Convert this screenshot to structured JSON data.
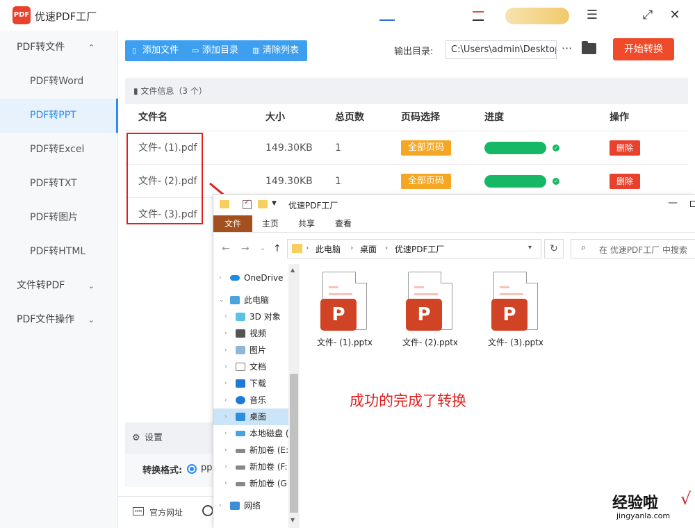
{
  "app": {
    "logo_text": "PDF",
    "title": "优速PDF工厂",
    "menu_glyph": "☰",
    "fullscreen_glyph": "⤢",
    "close_glyph": "✕"
  },
  "sidebar": {
    "groups": [
      {
        "label": "PDF转文件",
        "chevron": "⌃"
      },
      {
        "label": "文件转PDF",
        "chevron": "⌄"
      },
      {
        "label": "PDF文件操作",
        "chevron": "⌄"
      }
    ],
    "items": [
      {
        "label": "PDF转Word"
      },
      {
        "label": "PDF转PPT"
      },
      {
        "label": "PDF转Excel"
      },
      {
        "label": "PDF转TXT"
      },
      {
        "label": "PDF转图片"
      },
      {
        "label": "PDF转HTML"
      }
    ],
    "active_item": "PDF转PPT"
  },
  "toolbar": {
    "add_file": "添加文件",
    "add_dir": "添加目录",
    "clear_list": "清除列表",
    "output_label": "输出目录:",
    "output_path": "C:\\Users\\admin\\Desktop",
    "more_glyph": "···",
    "start": "开始转换"
  },
  "filelist": {
    "info": "文件信息（3 个）",
    "headers": {
      "name": "文件名",
      "size": "大小",
      "pages": "总页数",
      "page_select": "页码选择",
      "progress": "进度",
      "action": "操作"
    },
    "rows": [
      {
        "name": "文件- (1).pdf",
        "size": "149.30KB",
        "pages": "1",
        "page_select": "全部页码",
        "delete": "删除",
        "progress": 1.0
      },
      {
        "name": "文件- (2).pdf",
        "size": "149.30KB",
        "pages": "1",
        "page_select": "全部页码",
        "delete": "删除",
        "progress": 1.0
      },
      {
        "name": "文件- (3).pdf"
      }
    ]
  },
  "settings": {
    "title": "设置",
    "format_label": "转换格式:",
    "format_value": "pp"
  },
  "footer": {
    "site_icon": "com",
    "site_link": "官方网址"
  },
  "explorer": {
    "title": "优速PDF工厂",
    "ribbon": {
      "file": "文件",
      "home": "主页",
      "share": "共享",
      "view": "查看"
    },
    "nav_glyphs": {
      "back": "←",
      "forward": "→",
      "recent": "⌄",
      "up": "↑"
    },
    "breadcrumb": [
      "此电脑",
      "桌面",
      "优速PDF工厂"
    ],
    "crumb_sep": "›",
    "refresh_glyph": "↻",
    "search_placeholder": "在 优速PDF工厂 中搜索",
    "nav_items": [
      {
        "label": "OneDrive",
        "icon": "cloud-icon"
      },
      {
        "label": "此电脑",
        "icon": "pc-icon"
      },
      {
        "label": "3D 对象",
        "icon": "cube-icon"
      },
      {
        "label": "视频",
        "icon": "video-icon"
      },
      {
        "label": "图片",
        "icon": "picture-icon"
      },
      {
        "label": "文档",
        "icon": "document-icon"
      },
      {
        "label": "下载",
        "icon": "download-icon"
      },
      {
        "label": "音乐",
        "icon": "music-icon"
      },
      {
        "label": "桌面",
        "icon": "desktop-icon"
      },
      {
        "label": "本地磁盘 (",
        "icon": "drive-icon"
      },
      {
        "label": "新加卷 (E:",
        "icon": "drive-icon"
      },
      {
        "label": "新加卷 (F:",
        "icon": "drive-icon"
      },
      {
        "label": "新加卷 (G",
        "icon": "drive-icon"
      },
      {
        "label": "网络",
        "icon": "network-icon"
      }
    ],
    "selected_nav": "桌面",
    "files": [
      {
        "name": "文件- (1).pptx",
        "badge": "P"
      },
      {
        "name": "文件- (2).pptx",
        "badge": "P"
      },
      {
        "name": "文件- (3).pptx",
        "badge": "P"
      }
    ],
    "annotation": "成功的完成了转换"
  },
  "watermark": {
    "line1": "经验啦",
    "line2": "jingyanla.com",
    "check": "√"
  },
  "colors": {
    "accent_blue": "#2b8bf2",
    "toolbar_blue": "#3e9fef",
    "start_red": "#ef4b2a",
    "progress_green": "#17b865",
    "page_btn_orange": "#f5a623",
    "delete_red": "#e8412c",
    "annotation_red": "#e02020",
    "ppt_red": "#d04325"
  }
}
